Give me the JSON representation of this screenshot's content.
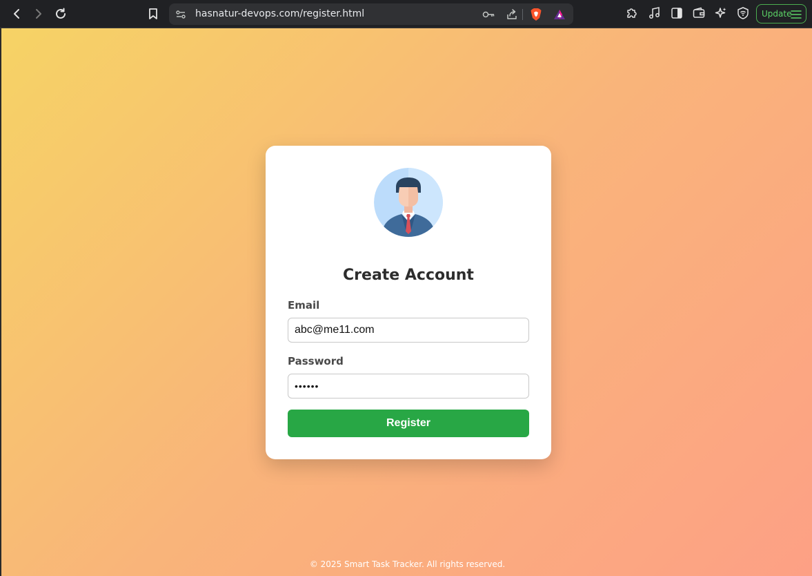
{
  "browser": {
    "url": "hasnatur-devops.com/register.html",
    "update_label": "Update"
  },
  "form": {
    "title": "Create Account",
    "email_label": "Email",
    "email_value": "abc@me11.com",
    "password_label": "Password",
    "password_value": "123456",
    "submit_label": "Register"
  },
  "footer": {
    "text": "© 2025 Smart Task Tracker. All rights reserved."
  },
  "colors": {
    "gradient_start": "#f6d365",
    "gradient_end": "#fda085",
    "button": "#28a745",
    "update_accent": "#4caf50"
  },
  "icons": [
    "back-icon",
    "forward-icon",
    "reload-icon",
    "bookmark-icon",
    "site-settings-icon",
    "key-icon",
    "share-icon",
    "brave-shields-icon",
    "brave-rewards-icon",
    "extensions-icon",
    "media-icon",
    "sidebar-icon",
    "wallet-icon",
    "leo-ai-icon",
    "vpn-icon",
    "menu-icon",
    "user-avatar-icon"
  ]
}
